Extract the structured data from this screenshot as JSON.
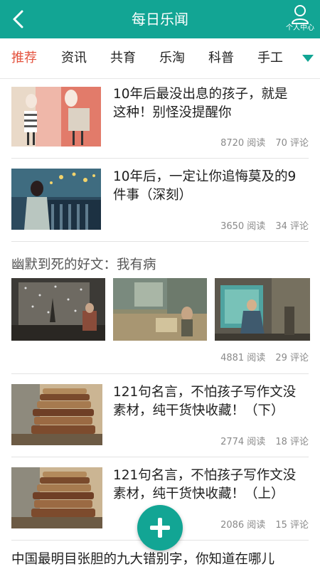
{
  "header": {
    "title": "每日乐闻",
    "profile_label": "个人中心",
    "back_icon": "chevron-left-icon",
    "profile_icon": "user-icon"
  },
  "tabs": [
    {
      "label": "推荐",
      "active": true
    },
    {
      "label": "资讯",
      "active": false
    },
    {
      "label": "共育",
      "active": false
    },
    {
      "label": "乐淘",
      "active": false
    },
    {
      "label": "科普",
      "active": false
    },
    {
      "label": "手工",
      "active": false
    }
  ],
  "articles": [
    {
      "title_line1": "10年后最没出息的孩子，就是",
      "title_line2": "这种！别怪没提醒你",
      "reads": "8720 阅读",
      "comments": "70 评论"
    },
    {
      "title_line1": "10年后，一定让你追悔莫及的9",
      "title_line2": "件事（深刻）",
      "reads": "3650 阅读",
      "comments": "34 评论"
    },
    {
      "title": "幽默到死的好文：我有病",
      "reads": "4881 阅读",
      "comments": "29 评论"
    },
    {
      "title_line1": "121句名言，不怕孩子写作文没",
      "title_line2": "素材，纯干货快收藏！（下）",
      "reads": "2774 阅读",
      "comments": "18 评论"
    },
    {
      "title_line1": "121句名言，不怕孩子写作文没",
      "title_line2": "素材，纯干货快收藏！（上）",
      "reads": "2086 阅读",
      "comments": "15 评论"
    },
    {
      "title_line1": "中国最明目张胆的九大错别字，你知道在哪儿"
    }
  ],
  "colors": {
    "brand": "#12a594",
    "active_tab": "#e4533f"
  },
  "fab_icon": "plus-icon"
}
